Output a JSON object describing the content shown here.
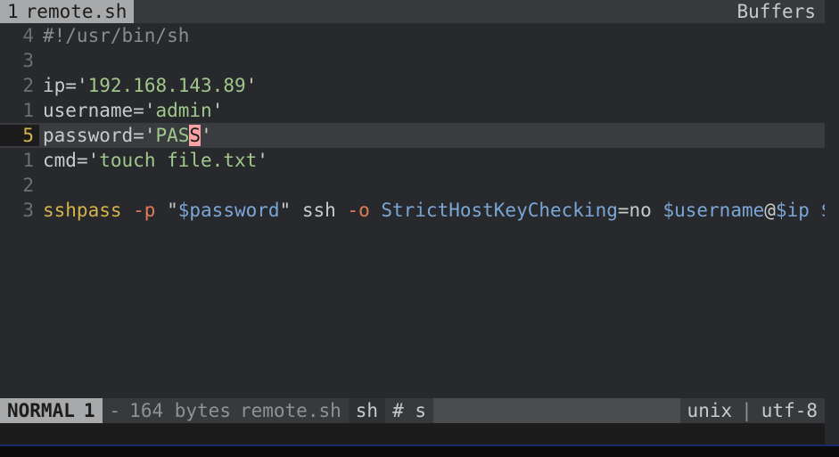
{
  "tab": {
    "index": "1",
    "filename": "remote.sh"
  },
  "buffers_label": "Buffers",
  "code": {
    "lines": [
      {
        "rel": "4",
        "tokens": [
          [
            "c-comment",
            "#!/usr/bin/sh"
          ]
        ]
      },
      {
        "rel": "3",
        "tokens": []
      },
      {
        "rel": "2",
        "tokens": [
          [
            "c-var",
            "ip"
          ],
          [
            "c-op",
            "="
          ],
          [
            "c-strq",
            "'"
          ],
          [
            "c-str",
            "192.168.143.89"
          ],
          [
            "c-strq",
            "'"
          ]
        ]
      },
      {
        "rel": "1",
        "tokens": [
          [
            "c-var",
            "username"
          ],
          [
            "c-op",
            "="
          ],
          [
            "c-strq",
            "'"
          ],
          [
            "c-str",
            "admin"
          ],
          [
            "c-strq",
            "'"
          ]
        ]
      },
      {
        "rel": "5",
        "current": true,
        "tokens_pre": [
          [
            "c-var",
            "password"
          ],
          [
            "c-op",
            "="
          ],
          [
            "c-strq",
            "'"
          ],
          [
            "c-str",
            "PAS"
          ]
        ],
        "cursor_char": "S",
        "tokens_post": [
          [
            "c-strq",
            "'"
          ]
        ]
      },
      {
        "rel": "1",
        "tokens": [
          [
            "c-var",
            "cmd"
          ],
          [
            "c-op",
            "="
          ],
          [
            "c-strq",
            "'"
          ],
          [
            "c-str",
            "touch file.txt"
          ],
          [
            "c-strq",
            "'"
          ]
        ]
      },
      {
        "rel": "2",
        "tokens": []
      },
      {
        "rel": "3",
        "tokens": [
          [
            "c-cmd",
            "sshpass"
          ],
          [
            "",
            ""
          ],
          [
            "c-flag",
            " -p "
          ],
          [
            "c-strq",
            "\""
          ],
          [
            "c-param",
            "$password"
          ],
          [
            "c-strq",
            "\""
          ],
          [
            "c-var",
            " ssh "
          ],
          [
            "c-flag",
            "-o "
          ],
          [
            "c-param",
            "StrictHostKeyChecking"
          ],
          [
            "c-op",
            "="
          ],
          [
            "c-var",
            "no "
          ],
          [
            "c-param",
            "$username"
          ],
          [
            "c-punc",
            "@"
          ],
          [
            "c-param",
            "$ip"
          ],
          [
            "c-var",
            " "
          ],
          [
            "c-param",
            "$cmd"
          ]
        ]
      }
    ]
  },
  "status": {
    "mode": "NORMAL",
    "mode_n": "1",
    "dash": "-",
    "bytes": "164 bytes",
    "filename": "remote.sh",
    "filetype": "sh",
    "flags": "# s",
    "fileformat": "unix",
    "sep": "|",
    "encoding": "utf-8"
  }
}
